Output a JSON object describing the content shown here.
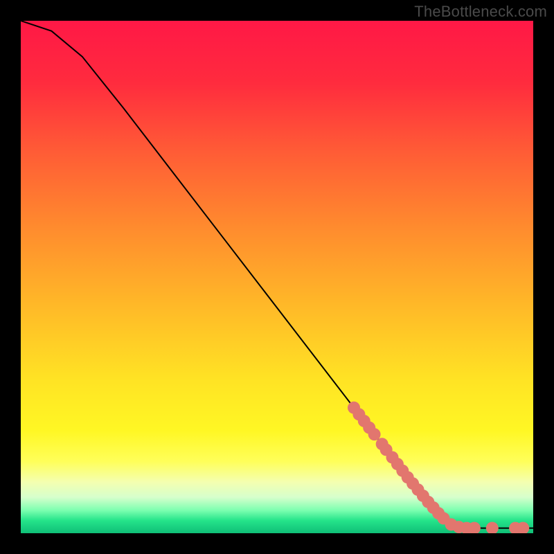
{
  "watermark": "TheBottleneck.com",
  "chart_data": {
    "type": "line",
    "title": "",
    "xlabel": "",
    "ylabel": "",
    "x_range": [
      0,
      100
    ],
    "y_range": [
      0,
      100
    ],
    "curve": [
      {
        "x": 0,
        "y": 100
      },
      {
        "x": 6,
        "y": 98
      },
      {
        "x": 12,
        "y": 93
      },
      {
        "x": 20,
        "y": 83
      },
      {
        "x": 30,
        "y": 70
      },
      {
        "x": 40,
        "y": 57
      },
      {
        "x": 50,
        "y": 44
      },
      {
        "x": 60,
        "y": 31
      },
      {
        "x": 70,
        "y": 18
      },
      {
        "x": 78,
        "y": 8
      },
      {
        "x": 83,
        "y": 2.5
      },
      {
        "x": 86,
        "y": 1.2
      },
      {
        "x": 90,
        "y": 1.0
      },
      {
        "x": 95,
        "y": 1.0
      },
      {
        "x": 100,
        "y": 1.0
      }
    ],
    "markers": [
      {
        "x": 65.0,
        "y": 24.5
      },
      {
        "x": 66.0,
        "y": 23.2
      },
      {
        "x": 67.0,
        "y": 21.9
      },
      {
        "x": 68.0,
        "y": 20.6
      },
      {
        "x": 69.0,
        "y": 19.3
      },
      {
        "x": 70.5,
        "y": 17.4
      },
      {
        "x": 71.3,
        "y": 16.3
      },
      {
        "x": 72.5,
        "y": 14.8
      },
      {
        "x": 73.5,
        "y": 13.5
      },
      {
        "x": 74.5,
        "y": 12.2
      },
      {
        "x": 75.5,
        "y": 10.9
      },
      {
        "x": 76.5,
        "y": 9.7
      },
      {
        "x": 77.5,
        "y": 8.5
      },
      {
        "x": 78.5,
        "y": 7.3
      },
      {
        "x": 79.5,
        "y": 6.1
      },
      {
        "x": 80.5,
        "y": 5.0
      },
      {
        "x": 81.5,
        "y": 3.9
      },
      {
        "x": 82.5,
        "y": 2.9
      },
      {
        "x": 84.0,
        "y": 1.7
      },
      {
        "x": 85.5,
        "y": 1.2
      },
      {
        "x": 87.0,
        "y": 1.0
      },
      {
        "x": 88.5,
        "y": 1.0
      },
      {
        "x": 92.0,
        "y": 1.0
      },
      {
        "x": 96.5,
        "y": 1.0
      },
      {
        "x": 98.0,
        "y": 1.0
      }
    ],
    "marker_color": "#e2766e",
    "curve_color": "#000000",
    "gradient_stops": [
      {
        "pos": 0.0,
        "color": "#ff1846"
      },
      {
        "pos": 0.12,
        "color": "#ff2b3e"
      },
      {
        "pos": 0.25,
        "color": "#ff5a36"
      },
      {
        "pos": 0.4,
        "color": "#ff8a2e"
      },
      {
        "pos": 0.55,
        "color": "#ffb728"
      },
      {
        "pos": 0.7,
        "color": "#ffe324"
      },
      {
        "pos": 0.8,
        "color": "#fff724"
      },
      {
        "pos": 0.86,
        "color": "#ffff5a"
      },
      {
        "pos": 0.9,
        "color": "#f4ffb0"
      },
      {
        "pos": 0.93,
        "color": "#d6ffcc"
      },
      {
        "pos": 0.955,
        "color": "#7dffb0"
      },
      {
        "pos": 0.975,
        "color": "#25e48a"
      },
      {
        "pos": 1.0,
        "color": "#0fbf77"
      }
    ]
  }
}
